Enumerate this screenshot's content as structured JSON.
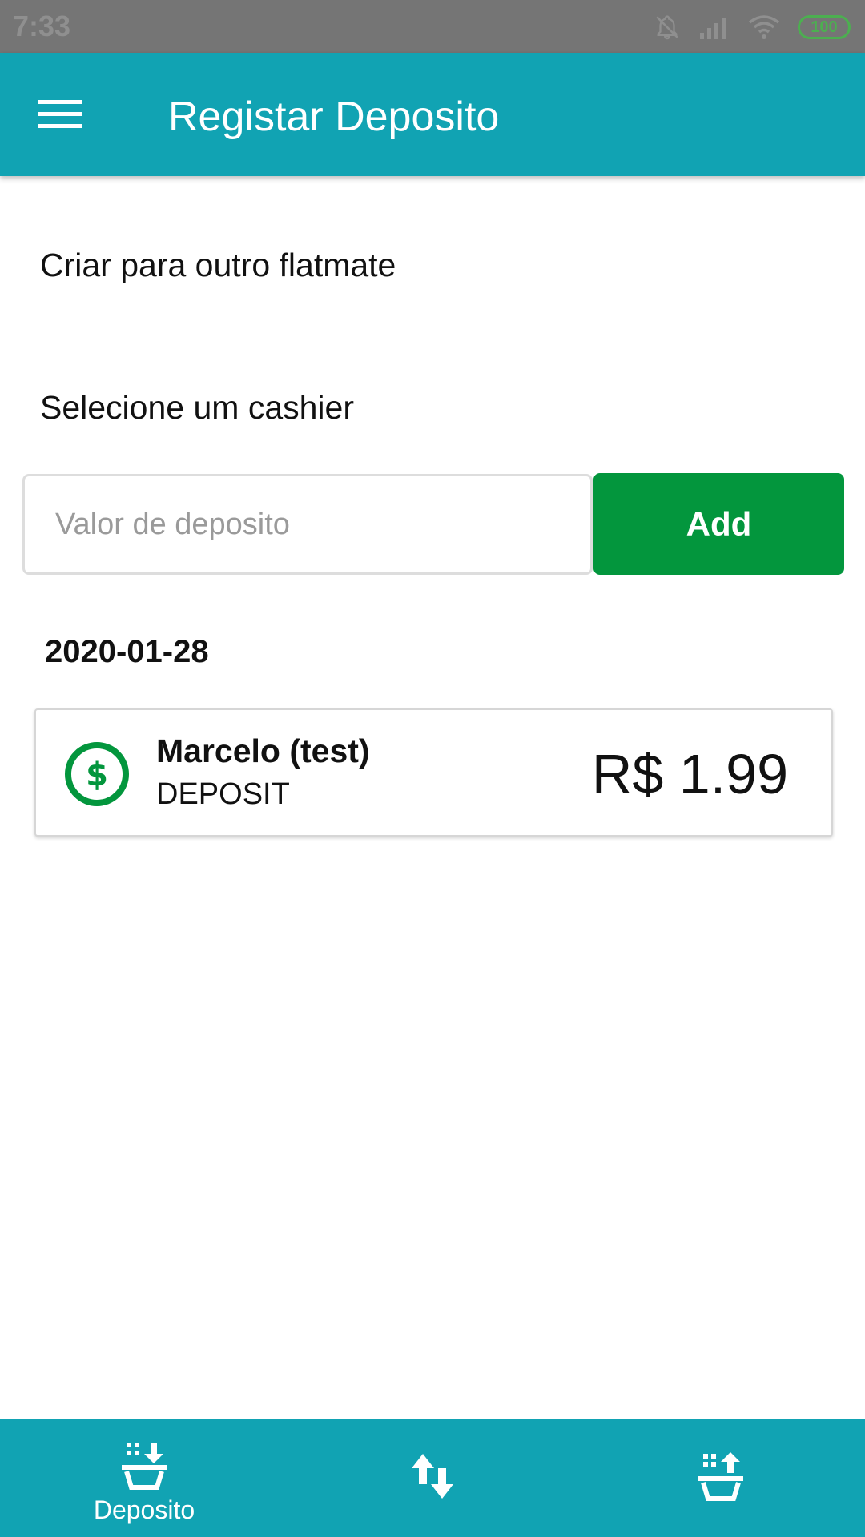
{
  "status_bar": {
    "time": "7:33",
    "battery": "100",
    "icons": [
      "bell-off-icon",
      "signal-icon",
      "wifi-icon",
      "battery-icon"
    ]
  },
  "app_bar": {
    "title": "Registar Deposito",
    "menu_icon": "hamburger-menu-icon"
  },
  "form": {
    "create_other_label": "Criar para outro flatmate",
    "cashier_label": "Selecione um cashier",
    "deposit_placeholder": "Valor de deposito",
    "deposit_value": "",
    "add_label": "Add"
  },
  "transactions": {
    "date": "2020-01-28",
    "items": [
      {
        "name": "Marcelo (test)",
        "type": "DEPOSIT",
        "amount": "R$ 1.99",
        "icon": "dollar-circle-icon"
      }
    ]
  },
  "bottom_nav": {
    "items": [
      {
        "label": "Deposito",
        "icon": "basket-deposit-icon",
        "active": true
      },
      {
        "label": "",
        "icon": "transfer-arrows-icon",
        "active": false
      },
      {
        "label": "",
        "icon": "basket-withdraw-icon",
        "active": false
      }
    ]
  },
  "colors": {
    "primary": "#11a3b3",
    "accent_green": "#03963d",
    "status_bar": "#757575"
  }
}
